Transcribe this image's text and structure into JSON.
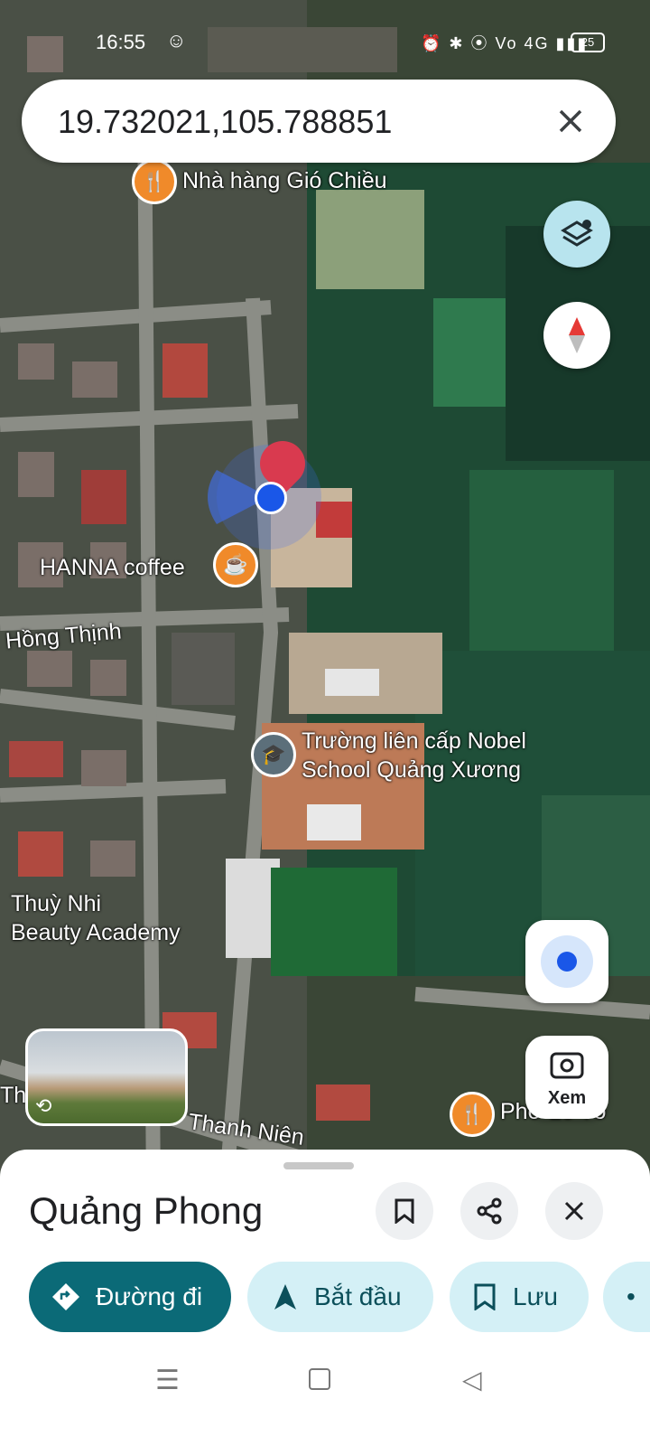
{
  "status": {
    "time": "16:55",
    "battery": "25",
    "icons": [
      "alarm-icon",
      "bluetooth-icon",
      "location-icon",
      "volte-icon",
      "4g-signal-icon"
    ]
  },
  "search": {
    "query": "19.732021,105.788851"
  },
  "map": {
    "labels": {
      "restaurant_top": "Nhà hàng Gió Chiều",
      "coffee": "HANNA coffee",
      "road_hong_thinh": "Hồng Thịnh",
      "school_line1": "Trường liên cấp Nobel",
      "school_line2": "School Quảng Xương",
      "beauty_line1": "Thuỳ Nhi",
      "beauty_line2": "Beauty Academy",
      "road_thanh_nien": "Thanh Niên",
      "road_tha": "Tha",
      "restaurant_bottom": "Phở Lê Tô"
    },
    "xem_label": "Xem"
  },
  "sheet": {
    "place_name": "Quảng Phong",
    "actions": [
      "Đường đi",
      "Bắt đầu",
      "Lưu"
    ]
  },
  "colors": {
    "accent": "#0b6a77",
    "chip_bg": "#d4f0f6",
    "pin_red": "#d93a4f",
    "blue_dot": "#1a57e8",
    "poi_orange": "#f08a2a"
  }
}
